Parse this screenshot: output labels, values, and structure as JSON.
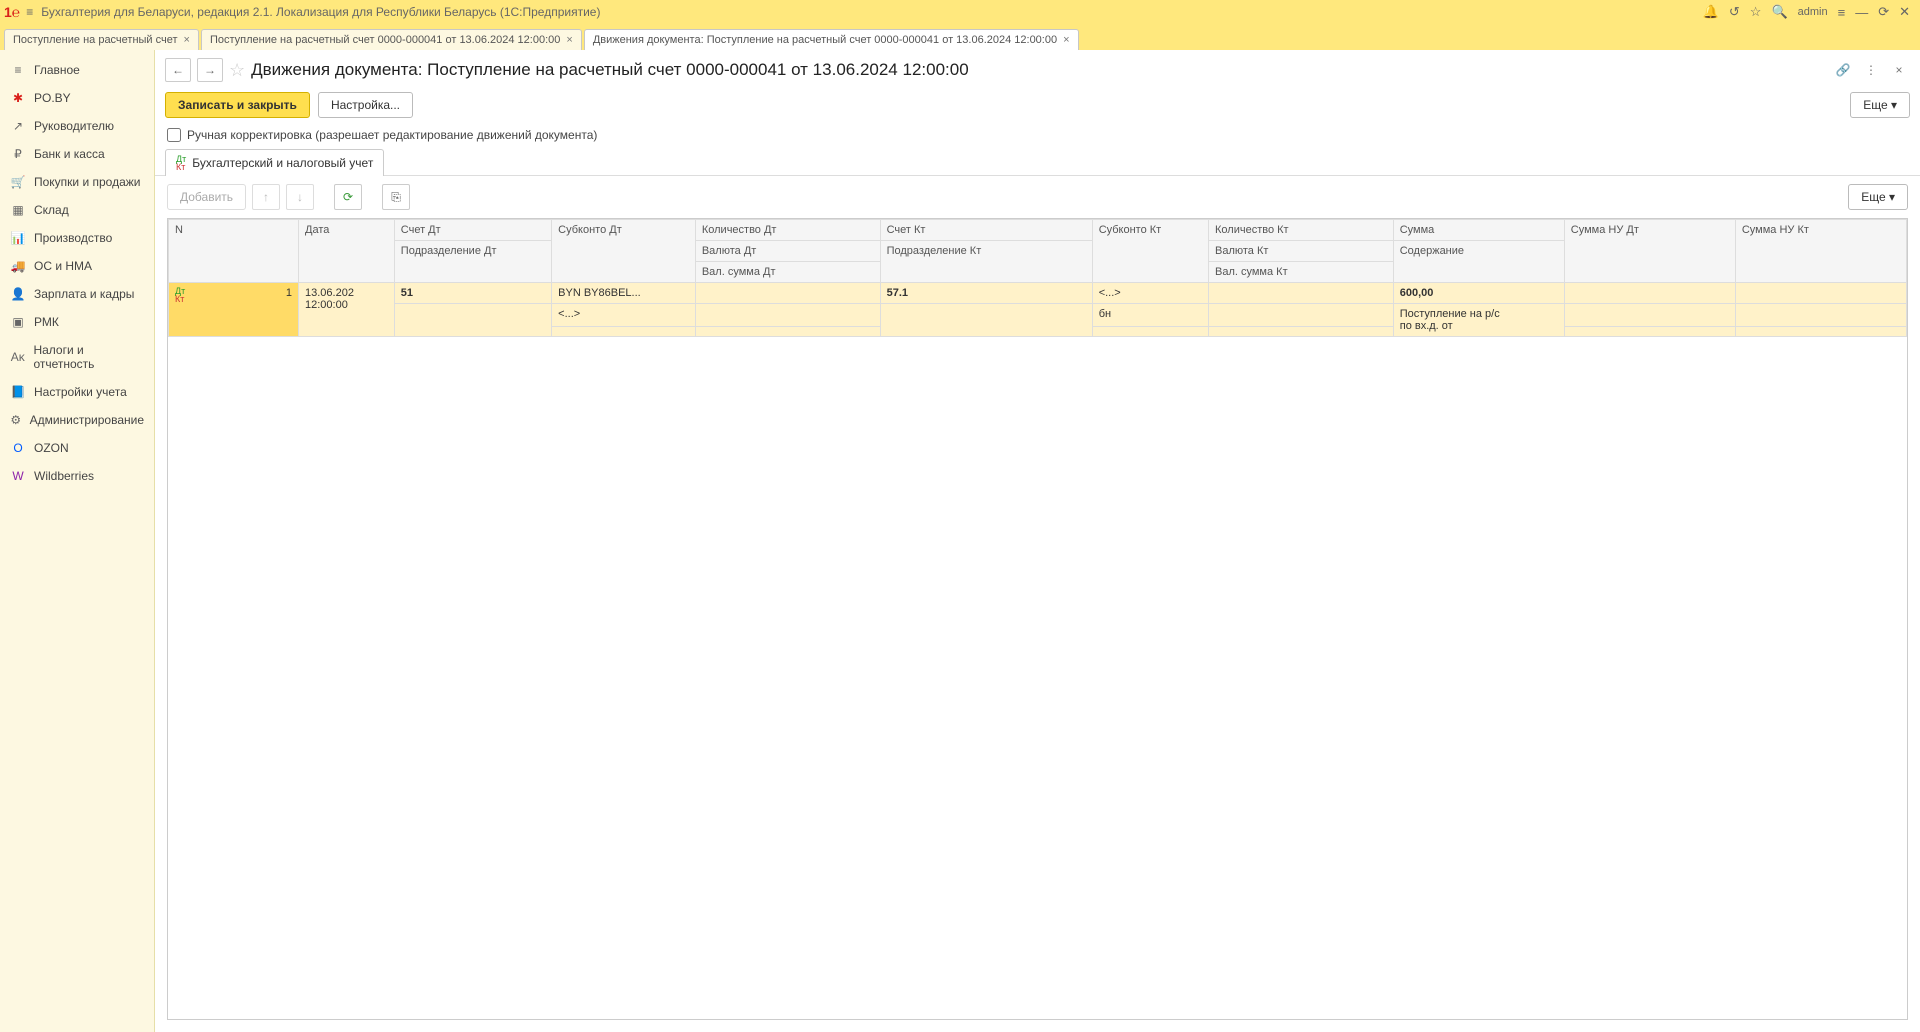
{
  "title_bar": {
    "app_title": "Бухгалтерия для Беларуси, редакция 2.1. Локализация для Республики Беларусь   (1С:Предприятие)",
    "user": "admin"
  },
  "doc_tabs": [
    {
      "label": "Поступление на расчетный счет",
      "active": false
    },
    {
      "label": "Поступление на расчетный счет 0000-000041 от 13.06.2024 12:00:00",
      "active": false
    },
    {
      "label": "Движения документа: Поступление на расчетный счет 0000-000041 от 13.06.2024 12:00:00",
      "active": true
    }
  ],
  "sidebar": {
    "items": [
      {
        "icon": "≡",
        "label": "Главное"
      },
      {
        "icon": "✱",
        "label": "PO.BY",
        "color": "#d9201a"
      },
      {
        "icon": "↗",
        "label": "Руководителю"
      },
      {
        "icon": "₽",
        "label": "Банк и касса"
      },
      {
        "icon": "🛒",
        "label": "Покупки и продажи"
      },
      {
        "icon": "▦",
        "label": "Склад"
      },
      {
        "icon": "📊",
        "label": "Производство"
      },
      {
        "icon": "🚚",
        "label": "ОС и НМА"
      },
      {
        "icon": "👤",
        "label": "Зарплата и кадры"
      },
      {
        "icon": "▣",
        "label": "РМК"
      },
      {
        "icon": "Аᴋ",
        "label": "Налоги и отчетность"
      },
      {
        "icon": "📘",
        "label": "Настройки учета"
      },
      {
        "icon": "⚙",
        "label": "Администрирование"
      },
      {
        "icon": "O",
        "label": "OZON",
        "color": "#005bff"
      },
      {
        "icon": "W",
        "label": "Wildberries",
        "color": "#8e24aa"
      }
    ]
  },
  "page": {
    "title": "Движения документа: Поступление на расчетный счет 0000-000041 от 13.06.2024 12:00:00",
    "btn_save_close": "Записать и закрыть",
    "btn_settings": "Настройка...",
    "btn_more": "Еще",
    "manual_edit_label": "Ручная корректировка (разрешает редактирование движений документа)",
    "inner_tab": "Бухгалтерский и налоговый учет",
    "btn_add": "Добавить"
  },
  "grid": {
    "headers": {
      "n": "N",
      "date": "Дата",
      "acc_dt": "Счет Дт",
      "sub_dt": "Субконто Дт",
      "qty_dt": "Количество Дт",
      "acc_kt": "Счет Кт",
      "sub_kt": "Субконто Кт",
      "qty_kt": "Количество Кт",
      "sum": "Сумма",
      "sum_nu_dt": "Сумма НУ Дт",
      "sum_nu_kt": "Сумма НУ Кт",
      "dept_dt": "Подразделение Дт",
      "cur_dt": "Валюта Дт",
      "valsum_dt": "Вал. сумма Дт",
      "dept_kt": "Подразделение Кт",
      "cur_kt": "Валюта Кт",
      "valsum_kt": "Вал. сумма Кт",
      "content": "Содержание"
    },
    "row": {
      "n": "1",
      "date_l1": "13.06.202",
      "date_l2": "12:00:00",
      "acc_dt": "51",
      "sub_dt": "BYN BY86BEL...",
      "acc_kt": "57.1",
      "sub_kt": "<...>",
      "cur_kt": "бн",
      "sum": "600,00",
      "content_l1": "Поступление на р/с",
      "content_l2": "по вх.д. от",
      "sub_dt2": "<...>"
    }
  }
}
